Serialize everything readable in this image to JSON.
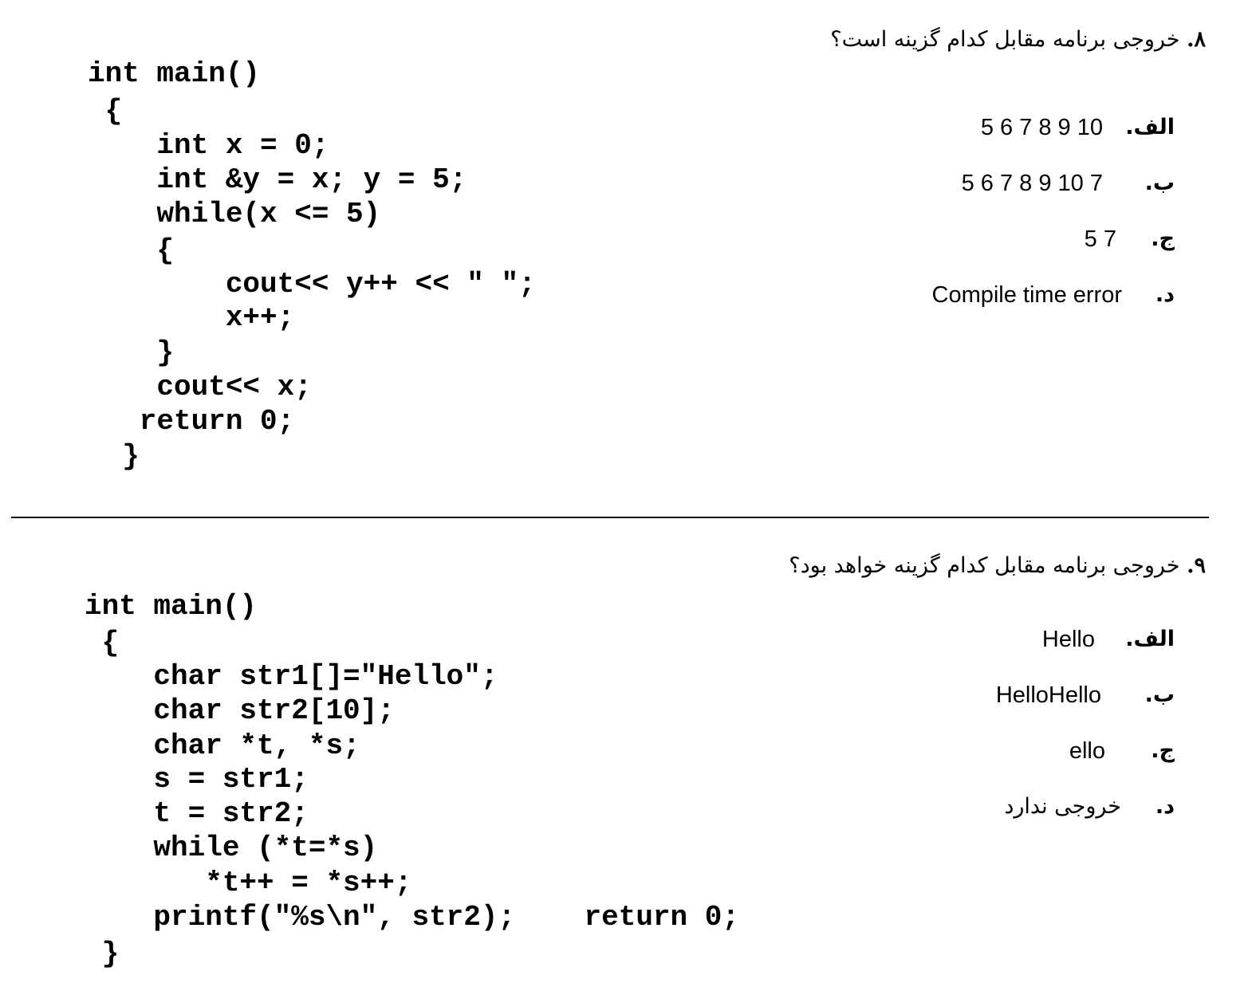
{
  "q8": {
    "number": "۸.",
    "text": "خروجی برنامه مقابل کدام گزینه است؟",
    "code": [
      "int main()",
      " {",
      "    int x = 0;",
      "    int &y = x; y = 5;",
      "    while(x <= 5)",
      "    {",
      "        cout<< y++ << \" \";",
      "        x++;",
      "    }",
      "    cout<< x;",
      "   return 0;",
      "  }"
    ],
    "options": [
      {
        "marker": "الف.",
        "value": "5 6 7 8 9 10"
      },
      {
        "marker": "ب.",
        "value": "5 6 7 8 9 10 7"
      },
      {
        "marker": "ج.",
        "value": "5 7"
      },
      {
        "marker": "د.",
        "value": "Compile time error"
      }
    ]
  },
  "q9": {
    "number": "۹.",
    "text": "خروجی برنامه مقابل کدام گزینه خواهد بود؟",
    "code": [
      "int main()",
      " {",
      "    char str1[]=\"Hello\";",
      "    char str2[10];",
      "    char *t, *s;",
      "    s = str1;",
      "    t = str2;",
      "    while (*t=*s)",
      "       *t++ = *s++;",
      "    printf(\"%s\\n\", str2);    return 0;",
      " }"
    ],
    "options": [
      {
        "marker": "الف.",
        "value": "Hello"
      },
      {
        "marker": "ب.",
        "value": "HelloHello"
      },
      {
        "marker": "ج.",
        "value": "ello"
      },
      {
        "marker": "د.",
        "value": "خروجی ندارد"
      }
    ]
  }
}
